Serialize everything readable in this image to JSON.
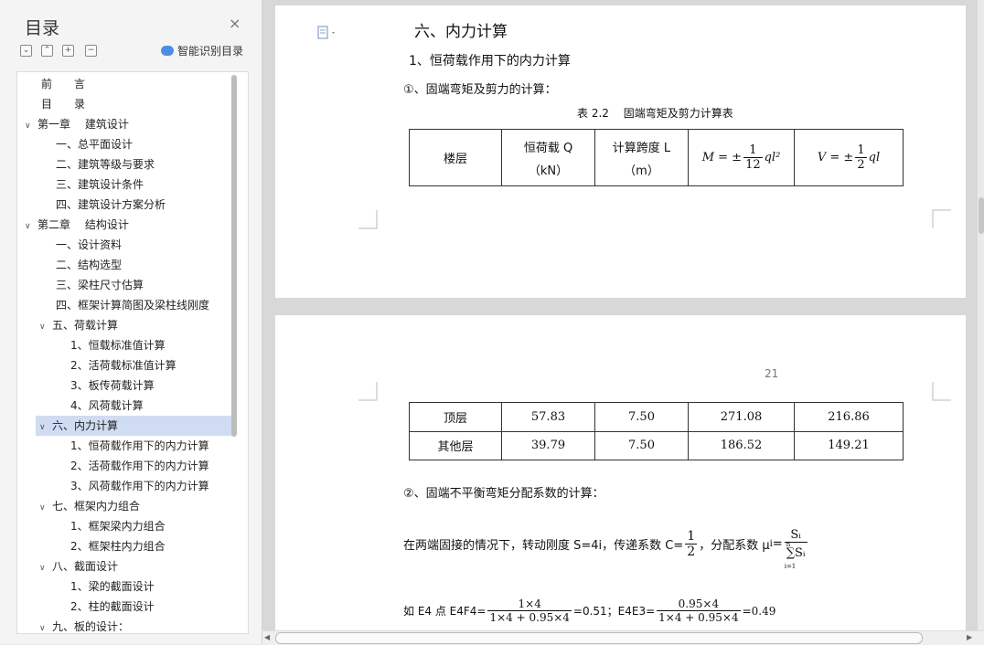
{
  "toc": {
    "title": "目录",
    "close_glyph": "×",
    "toolbar": [
      "⌄",
      "⌃",
      "+",
      "−"
    ],
    "ai_label": "智能识别目录",
    "items": [
      {
        "label": "前　　言",
        "level": 1,
        "chev": ""
      },
      {
        "label": "目　　录",
        "level": 1,
        "chev": ""
      },
      {
        "label": "第一章　 建筑设计",
        "level": 0,
        "chev": "v"
      },
      {
        "label": "一、总平面设计",
        "level": 2,
        "chev": ""
      },
      {
        "label": "二、建筑等级与要求",
        "level": 2,
        "chev": ""
      },
      {
        "label": "三、建筑设计条件",
        "level": 2,
        "chev": ""
      },
      {
        "label": "四、建筑设计方案分析",
        "level": 2,
        "chev": ""
      },
      {
        "label": "第二章　 结构设计",
        "level": 0,
        "chev": "v"
      },
      {
        "label": "一、设计资料",
        "level": 2,
        "chev": ""
      },
      {
        "label": "二、结构选型",
        "level": 2,
        "chev": ""
      },
      {
        "label": "三、梁柱尺寸估算",
        "level": 2,
        "chev": ""
      },
      {
        "label": "四、框架计算简图及梁柱线刚度",
        "level": 2,
        "chev": ""
      },
      {
        "label": "五、荷载计算",
        "level": 1.5,
        "chev": "v"
      },
      {
        "label": "1、恒载标准值计算",
        "level": 3,
        "chev": ""
      },
      {
        "label": "2、活荷载标准值计算",
        "level": 3,
        "chev": ""
      },
      {
        "label": "3、板传荷载计算",
        "level": 3,
        "chev": ""
      },
      {
        "label": "4、风荷载计算",
        "level": 3,
        "chev": ""
      },
      {
        "label": "六、内力计算",
        "level": 1.5,
        "chev": "v",
        "selected": true
      },
      {
        "label": "1、恒荷载作用下的内力计算",
        "level": 3,
        "chev": ""
      },
      {
        "label": "2、活荷载作用下的内力计算",
        "level": 3,
        "chev": ""
      },
      {
        "label": "3、风荷载作用下的内力计算",
        "level": 3,
        "chev": ""
      },
      {
        "label": "七、框架内力组合",
        "level": 1.5,
        "chev": "v"
      },
      {
        "label": "1、框架梁内力组合",
        "level": 3,
        "chev": ""
      },
      {
        "label": "2、框架柱内力组合",
        "level": 3,
        "chev": ""
      },
      {
        "label": "八、截面设计",
        "level": 1.5,
        "chev": "v"
      },
      {
        "label": "1、梁的截面设计",
        "level": 3,
        "chev": ""
      },
      {
        "label": "2、柱的截面设计",
        "level": 3,
        "chev": ""
      },
      {
        "label": "九、板的设计：",
        "level": 1.5,
        "chev": "v"
      }
    ]
  },
  "doc": {
    "section_heading": "六、内力计算",
    "sub_heading": "1、恒荷载作用下的内力计算",
    "item1": "①、固端弯矩及剪力的计算：",
    "table_caption": "表 2.2　 固端弯矩及剪力计算表",
    "headers": {
      "floor": "楼层",
      "load_line1": "恒荷载 Q",
      "load_line2": "（kN）",
      "span_line1": "计算跨度 L",
      "span_line2": "（m）",
      "m_prefix": "M = ±",
      "m_num": "1",
      "m_den": "12",
      "m_suffix": "ql²",
      "v_prefix": "V = ±",
      "v_num": "1",
      "v_den": "2",
      "v_suffix": "ql"
    },
    "page_number": "21",
    "rows": [
      [
        "顶层",
        "57.83",
        "7.50",
        "271.08",
        "216.86"
      ],
      [
        "其他层",
        "39.79",
        "7.50",
        "186.52",
        "149.21"
      ]
    ],
    "item2": "②、固端不平衡弯矩分配系数的计算：",
    "para": {
      "text1": "在两端固接的情况下，转动刚度 S=4i，传递系数 C=",
      "c_num": "1",
      "c_den": "2",
      "text2": "，分配系数 μ",
      "mu_sub": "i",
      "text3": " = ",
      "mu_num": "Sᵢ",
      "mu_den": "∑Sᵢ",
      "sum_top": "n",
      "sum_bot": "i=1"
    },
    "last": {
      "text1": "如 E4 点 E4F4=",
      "f1_num": "1×4",
      "f1_den": "1×4 + 0.95×4",
      "text2": "=0.51；E4E3=",
      "f2_num": "0.95×4",
      "f2_den": "1×4 + 0.95×4",
      "text3": "=0.49"
    }
  }
}
